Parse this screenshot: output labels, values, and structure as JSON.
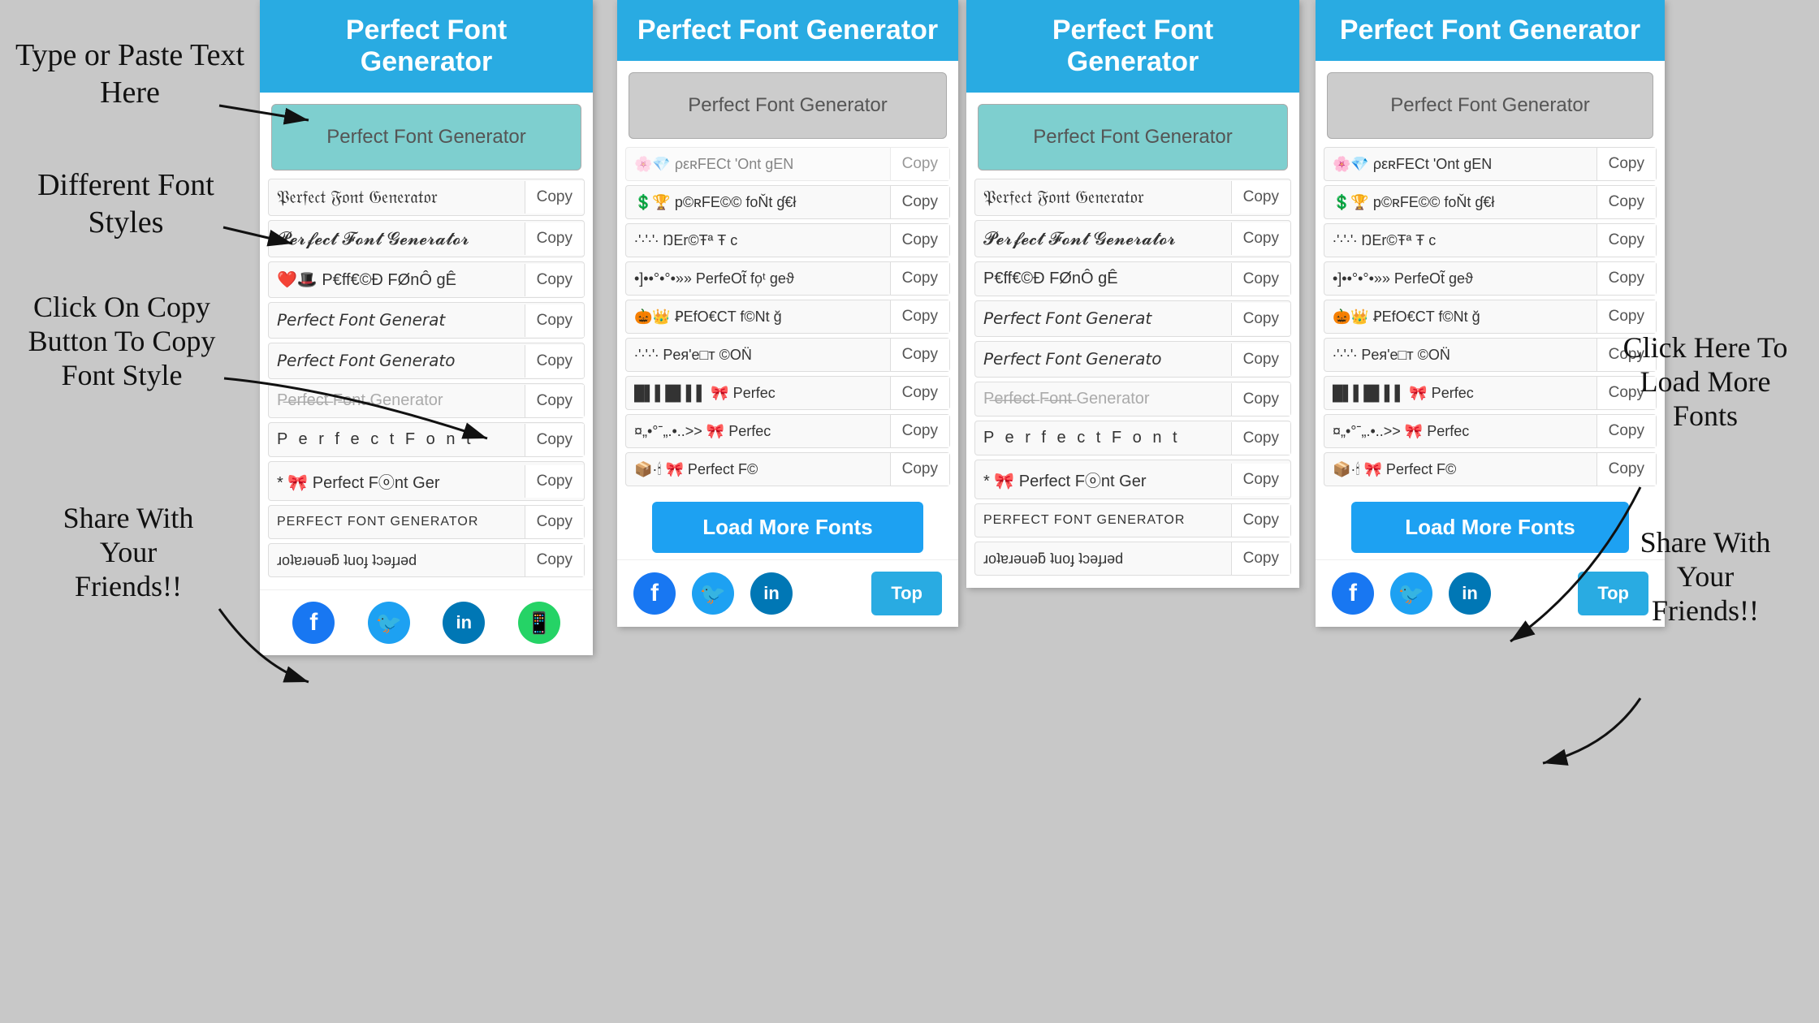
{
  "leftPanel": {
    "header": "Perfect Font Generator",
    "inputPlaceholder": "Perfect Font Generator",
    "fonts": [
      {
        "text": "𝔓𝔢𝔯𝔣𝔢𝔠𝔱 𝔉𝔬𝔫𝔱 𝔊𝔢𝔫𝔢𝔯𝔞𝔱𝔬𝔯",
        "copy": "Copy"
      },
      {
        "text": "𝓟𝓮𝓻𝓯𝓮𝓬𝓽 𝓕𝓸𝓷𝓽 𝓖𝓮𝓷𝓮𝓻𝓪𝓽𝓸𝓻",
        "copy": "Copy"
      },
      {
        "text": "❤️🎩 P€ff€©Ð FØnÔ gÊ",
        "copy": "Copy"
      },
      {
        "text": "𝘗𝘦𝘳𝘧𝘦𝘤𝘵 𝘍𝘰𝘯𝘵 𝘎𝘦𝘯𝘦𝘳𝘢𝘵",
        "copy": "Copy"
      },
      {
        "text": "𝘗𝘦𝘳𝘧𝘦𝘤𝘵 𝘍𝘰𝘯𝘵 𝘎𝘦𝘯𝘦𝘳𝘢𝘵𝘰",
        "copy": "Copy"
      },
      {
        "text": "P̶e̶r̶f̶e̶c̶t̶ F̶o̶n̶t̶ Generator",
        "copy": "Copy"
      },
      {
        "text": "P e r f e c t  F o n t",
        "copy": "Copy"
      },
      {
        "text": "* 🎀 Perfect Fⓞnt Ger",
        "copy": "Copy"
      },
      {
        "text": "PERFECT FONT GENERATOR",
        "copy": "Copy"
      },
      {
        "text": "ɹoʇɐɹǝuǝƃ ʇuoɟ ʇɔǝɟɹǝd",
        "copy": "Copy"
      }
    ],
    "social": {
      "facebook": "f",
      "twitter": "🐦",
      "linkedin": "in",
      "whatsapp": "📱"
    }
  },
  "rightPanel": {
    "header": "Perfect Font Generator",
    "inputValue": "Perfect Font Generator",
    "fonts": [
      {
        "text": "🌸💎 ρεʀFECt 'Ont gEN",
        "copy": "Copy"
      },
      {
        "text": "💲🏆 p©ʀFE©© foŇt ɠ€ł",
        "copy": "Copy"
      },
      {
        "text": "∙'∙'∙'∙ ŊEr©Ŧª Ŧ c",
        "copy": "Copy"
      },
      {
        "text": "•]••°•°•»» PеrfeOt̃ fo᷊ᵗ geϑ",
        "copy": "Copy"
      },
      {
        "text": "🎃👑 ꝐEfO€CT f©Nt ğ",
        "copy": "Copy"
      },
      {
        "text": "∙'∙'∙'∙ Pеяʹe□т ©ON̈",
        "copy": "Copy"
      },
      {
        "text": "█▌▌█▌▌▌ 🎀 Perfec",
        "copy": "Copy"
      },
      {
        "text": "¤„•°ˉ„.•..>> 🎀 Perfec",
        "copy": "Copy"
      },
      {
        "text": "📦·🕯 🎀 Perfect F©",
        "copy": "Copy"
      }
    ],
    "loadMore": "Load More Fonts",
    "top": "Top",
    "social": {
      "facebook": "f",
      "twitter": "t",
      "linkedin": "in"
    }
  },
  "leftPanel2": {
    "header": "Perfect Font Generator",
    "inputValue": "Perfect Font Generator",
    "fonts": [
      {
        "text": "𝔓𝔢𝔯𝔣𝔢𝔠𝔱 𝔉𝔬𝔫𝔱 𝔊𝔢𝔫𝔢𝔯𝔞𝔱𝔬𝔯",
        "copy": "Copy"
      },
      {
        "text": "𝓟𝓮𝓻𝓯𝓮𝓬𝓽 𝓕𝓸𝓷𝓽 𝓖𝓮𝓷𝓮𝓻𝓪𝓽𝓸𝓻",
        "copy": "Copy"
      },
      {
        "text": "P€ff€©Ð FØnÔ gÊ",
        "copy": "Copy"
      },
      {
        "text": "𝘗𝘦𝘳𝘧𝘦𝘤𝘵 𝘍𝘰𝘯𝘵 𝘎𝘦𝘯𝘦𝘳𝘢𝘵",
        "copy": "Copy"
      },
      {
        "text": "𝘗𝘦𝘳𝘧𝘦𝘤𝘵 𝘍𝘰𝘯𝘵 𝘎𝘦𝘯𝘦𝘳𝘢𝘵𝘰",
        "copy": "Copy"
      },
      {
        "text": "P̶e̶r̶f̶e̶c̶t̶ F̶o̶n̶t̶ Generator",
        "copy": "Copy"
      },
      {
        "text": "P e r f e c t  F o n t",
        "copy": "Copy"
      },
      {
        "text": "* 🎀 Perfect Fⓞnt Ger",
        "copy": "Copy"
      },
      {
        "text": "PERFECT FONT GENERATOR",
        "copy": "Copy"
      },
      {
        "text": "ɹoʇɐɹǝuǝƃ ʇuoɟ ʇɔǝɟɹǝd",
        "copy": "Copy"
      }
    ]
  },
  "rightPanel2": {
    "header": "Perfect Font Generator",
    "inputValue": "Perfect Font Generator",
    "fonts": [
      {
        "text": "🌸💎 ρεʀFECt 'Ont gEN",
        "copy": "Copy"
      },
      {
        "text": "💲🏆 p©ʀFE©© foŇt ɠ€ł",
        "copy": "Copy"
      },
      {
        "text": "∙'∙'∙'∙ ŊEr©Ŧª Ŧ c",
        "copy": "Copy"
      },
      {
        "text": "•]••°•°•»» PеrfeOt̃ geϑ",
        "copy": "Copy"
      },
      {
        "text": "🎃👑 ꝐEfO€CT f©Nt ğ",
        "copy": "Copy"
      },
      {
        "text": "∙'∙'∙'∙ Pеяʹe□т ©ON̈",
        "copy": "Copy"
      },
      {
        "text": "█▌▌█▌▌▌ 🎀 Perfec",
        "copy": "Copy"
      },
      {
        "text": "¤„•°ˉ„.•..>> 🎀 Perfec",
        "copy": "Copy"
      },
      {
        "text": "📦·🕯 🎀 Perfect F©",
        "copy": "Copy"
      }
    ],
    "loadMore": "Load More Fonts",
    "top": "Top"
  },
  "annotations": {
    "typeOrPaste": "Type or Paste Text\nHere",
    "differentFontStyles": "Different Font\nStyles",
    "clickOnCopy": "Click On Copy\nButton To Copy\nFont Style",
    "shareWithFriends": "Share With\nYour\nFriends!!",
    "clickHereToLoad": "Click Here To\nLoad More\nFonts",
    "shareWithFriends2": "Share With\nYour\nFriends!!"
  }
}
